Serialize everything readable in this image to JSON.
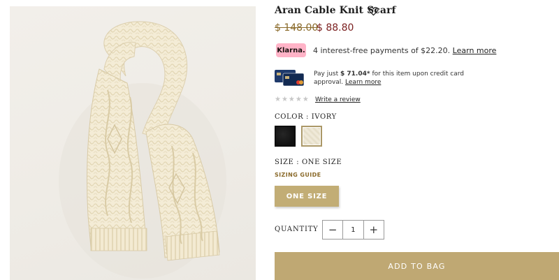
{
  "product": {
    "title": "Aran Cable Knit Scarf",
    "image_alt": "Ivory cable knit scarf"
  },
  "price": {
    "original": "$ 148.00",
    "sale": "$ 88.80"
  },
  "klarna": {
    "badge": "Klarna.",
    "text": "4 interest-free payments of $22.20.",
    "link": "Learn more"
  },
  "credit": {
    "prefix": "Pay just ",
    "amount": "$ 71.04*",
    "suffix": " for this item upon credit card approval.",
    "link": "Learn more"
  },
  "reviews": {
    "stars": "★★★★★",
    "rating": 0,
    "link": "Write a review"
  },
  "color": {
    "label": "COLOR :",
    "value": "IVORY",
    "swatches": [
      "black",
      "ivory"
    ],
    "selected": "ivory"
  },
  "size": {
    "label": "SIZE : ONE SIZE",
    "guide": "SIZING GUIDE",
    "option": "ONE SIZE"
  },
  "quantity": {
    "label": "QUANTITY",
    "minus": "−",
    "value": "1",
    "plus": "+"
  },
  "cta": {
    "add_to_bag": "ADD TO BAG"
  },
  "colors": {
    "gold": "#bfa873",
    "sale_red": "#7a1e1e",
    "klarna_pink": "#ffb3c7"
  }
}
